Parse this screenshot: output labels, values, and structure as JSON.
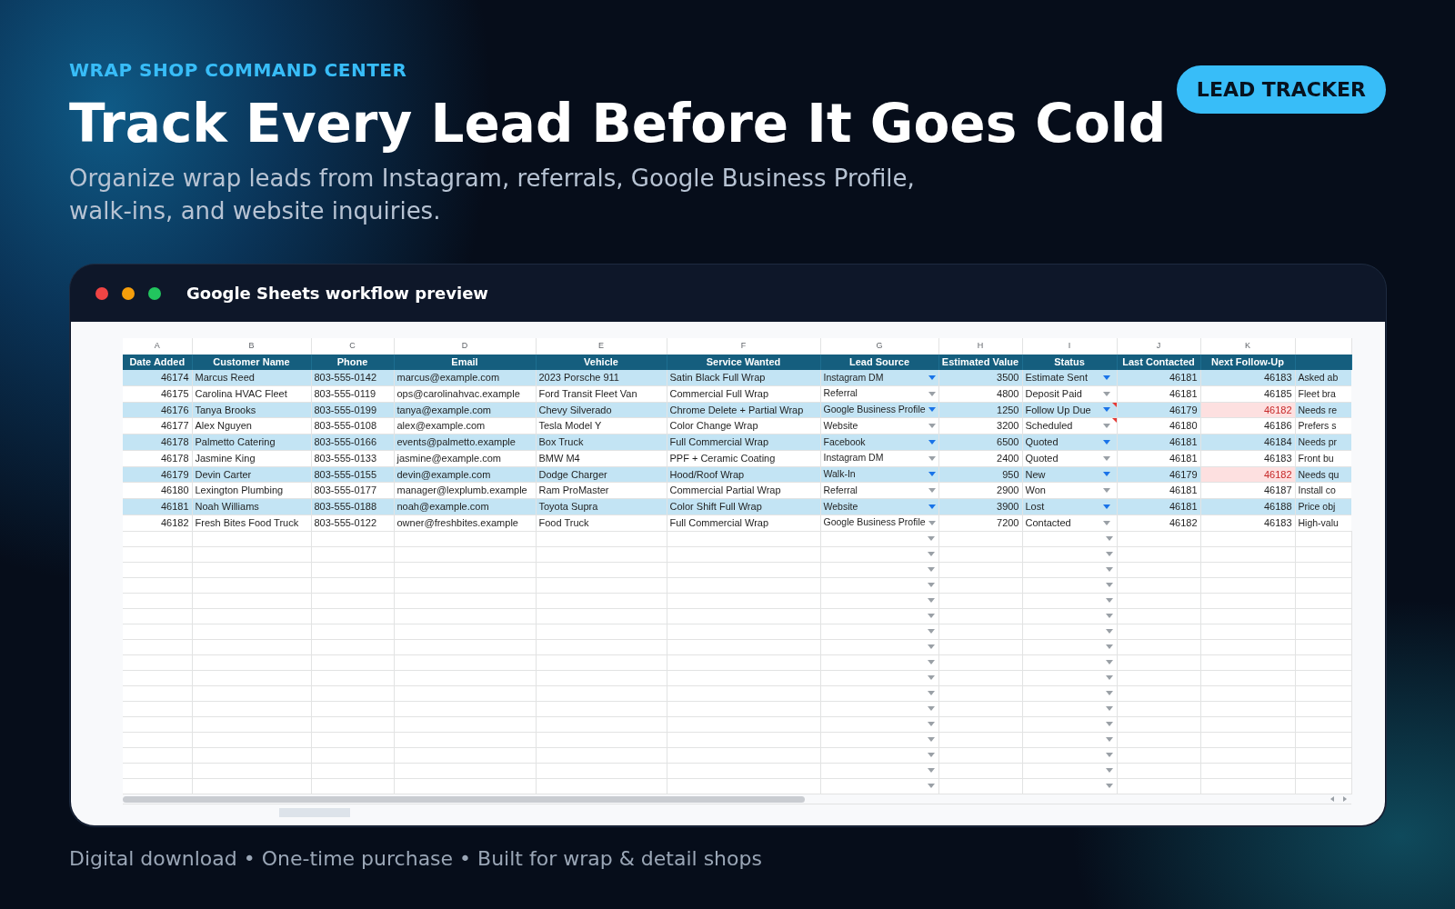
{
  "kicker": "WRAP SHOP COMMAND CENTER",
  "title": "Track Every Lead Before It Goes Cold",
  "subtitle": "Organize wrap leads from Instagram, referrals, Google Business Profile, walk-ins, and website inquiries.",
  "badge": "LEAD TRACKER",
  "window": {
    "title": "Google Sheets workflow preview"
  },
  "sheet": {
    "column_letters": [
      "A",
      "B",
      "C",
      "D",
      "E",
      "F",
      "G",
      "H",
      "I",
      "J",
      "K"
    ],
    "headers": [
      "Date Added",
      "Customer Name",
      "Phone",
      "Email",
      "Vehicle",
      "Service Wanted",
      "Lead Source",
      "Estimated Value",
      "Status",
      "Last Contacted",
      "Next Follow-Up"
    ],
    "rows": [
      {
        "date_added": "46174",
        "customer": "Marcus Reed",
        "phone": "803-555-0142",
        "email": "marcus@example.com",
        "vehicle": "2023 Porsche 911",
        "service": "Satin Black Full Wrap",
        "source": "Instagram DM",
        "value": "3500",
        "status": "Estimate Sent",
        "status_note": false,
        "last_contacted": "46181",
        "next_follow_up": "46183",
        "overdue": false,
        "column_12": "Asked ab"
      },
      {
        "date_added": "46175",
        "customer": "Carolina HVAC Fleet",
        "phone": "803-555-0119",
        "email": "ops@carolinahvac.example",
        "vehicle": "Ford Transit Fleet Van",
        "service": "Commercial Full Wrap",
        "source": "Referral",
        "value": "4800",
        "status": "Deposit Paid",
        "status_note": false,
        "last_contacted": "46181",
        "next_follow_up": "46185",
        "overdue": false,
        "column_12": "Fleet bra"
      },
      {
        "date_added": "46176",
        "customer": "Tanya Brooks",
        "phone": "803-555-0199",
        "email": "tanya@example.com",
        "vehicle": "Chevy Silverado",
        "service": "Chrome Delete + Partial Wrap",
        "source": "Google Business Profile",
        "value": "1250",
        "status": "Follow Up Due",
        "status_note": true,
        "last_contacted": "46179",
        "next_follow_up": "46182",
        "overdue": true,
        "column_12": "Needs re"
      },
      {
        "date_added": "46177",
        "customer": "Alex Nguyen",
        "phone": "803-555-0108",
        "email": "alex@example.com",
        "vehicle": "Tesla Model Y",
        "service": "Color Change Wrap",
        "source": "Website",
        "value": "3200",
        "status": "Scheduled",
        "status_note": true,
        "last_contacted": "46180",
        "next_follow_up": "46186",
        "overdue": false,
        "column_12": "Prefers s"
      },
      {
        "date_added": "46178",
        "customer": "Palmetto Catering",
        "phone": "803-555-0166",
        "email": "events@palmetto.example",
        "vehicle": "Box Truck",
        "service": "Full Commercial Wrap",
        "source": "Facebook",
        "value": "6500",
        "status": "Quoted",
        "status_note": false,
        "last_contacted": "46181",
        "next_follow_up": "46184",
        "overdue": false,
        "column_12": "Needs pr"
      },
      {
        "date_added": "46178",
        "customer": "Jasmine King",
        "phone": "803-555-0133",
        "email": "jasmine@example.com",
        "vehicle": "BMW M4",
        "service": "PPF + Ceramic Coating",
        "source": "Instagram DM",
        "value": "2400",
        "status": "Quoted",
        "status_note": false,
        "last_contacted": "46181",
        "next_follow_up": "46183",
        "overdue": false,
        "column_12": "Front bu"
      },
      {
        "date_added": "46179",
        "customer": "Devin Carter",
        "phone": "803-555-0155",
        "email": "devin@example.com",
        "vehicle": "Dodge Charger",
        "service": "Hood/Roof Wrap",
        "source": "Walk-In",
        "value": "950",
        "status": "New",
        "status_note": false,
        "last_contacted": "46179",
        "next_follow_up": "46182",
        "overdue": true,
        "column_12": "Needs qu"
      },
      {
        "date_added": "46180",
        "customer": "Lexington Plumbing",
        "phone": "803-555-0177",
        "email": "manager@lexplumb.example",
        "vehicle": "Ram ProMaster",
        "service": "Commercial Partial Wrap",
        "source": "Referral",
        "value": "2900",
        "status": "Won",
        "status_note": false,
        "last_contacted": "46181",
        "next_follow_up": "46187",
        "overdue": false,
        "column_12": "Install co"
      },
      {
        "date_added": "46181",
        "customer": "Noah Williams",
        "phone": "803-555-0188",
        "email": "noah@example.com",
        "vehicle": "Toyota Supra",
        "service": "Color Shift Full Wrap",
        "source": "Website",
        "value": "3900",
        "status": "Lost",
        "status_note": false,
        "last_contacted": "46181",
        "next_follow_up": "46188",
        "overdue": false,
        "column_12": "Price obj"
      },
      {
        "date_added": "46182",
        "customer": "Fresh Bites Food Truck",
        "phone": "803-555-0122",
        "email": "owner@freshbites.example",
        "vehicle": "Food Truck",
        "service": "Full Commercial Wrap",
        "source": "Google Business Profile",
        "value": "7200",
        "status": "Contacted",
        "status_note": false,
        "last_contacted": "46182",
        "next_follow_up": "46183",
        "overdue": false,
        "column_12": "High-valu"
      }
    ]
  },
  "footer": "Digital download • One-time purchase • Built for wrap & detail shops"
}
